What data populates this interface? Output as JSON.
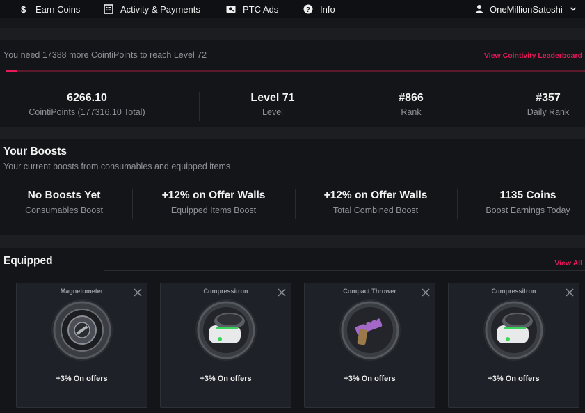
{
  "nav": {
    "items": [
      {
        "label": "Earn Coins",
        "icon": "dollar-icon"
      },
      {
        "label": "Activity & Payments",
        "icon": "list-icon"
      },
      {
        "label": "PTC Ads",
        "icon": "ad-icon"
      },
      {
        "label": "Info",
        "icon": "question-icon"
      }
    ],
    "username": "OneMillionSatoshi"
  },
  "level": {
    "message": "You need 17388 more CointiPoints to reach Level 72",
    "leaderboard_link": "View Cointivity Leaderboard",
    "progress_percent": 2
  },
  "stats": [
    {
      "value": "6266.10",
      "label": "CointiPoints (177316.10 Total)"
    },
    {
      "value": "Level 71",
      "label": "Level"
    },
    {
      "value": "#866",
      "label": "Rank"
    },
    {
      "value": "#357",
      "label": "Daily Rank"
    }
  ],
  "boosts": {
    "title": "Your Boosts",
    "subtitle": "Your current boosts from consumables and equipped items",
    "items": [
      {
        "value": "No Boosts Yet",
        "label": "Consumables Boost"
      },
      {
        "value": "+12% on Offer Walls",
        "label": "Equipped Items Boost"
      },
      {
        "value": "+12% on Offer Walls",
        "label": "Total Combined Boost"
      },
      {
        "value": "1135 Coins",
        "label": "Boost Earnings Today"
      }
    ]
  },
  "equipped": {
    "title": "Equipped",
    "view_all": "View All",
    "items": [
      {
        "name": "Magnetometer",
        "effect": "+3% On offers",
        "icon": "magnetometer-icon"
      },
      {
        "name": "Compressitron",
        "effect": "+3% On offers",
        "icon": "compressitron-icon"
      },
      {
        "name": "Compact Thrower",
        "effect": "+3% On offers",
        "icon": "compact-thrower-icon"
      },
      {
        "name": "Compressitron",
        "effect": "+3% On offers",
        "icon": "compressitron-icon"
      }
    ]
  },
  "colors": {
    "accent": "#e8185a",
    "background": "#141518",
    "muted_text": "#8f9298"
  }
}
